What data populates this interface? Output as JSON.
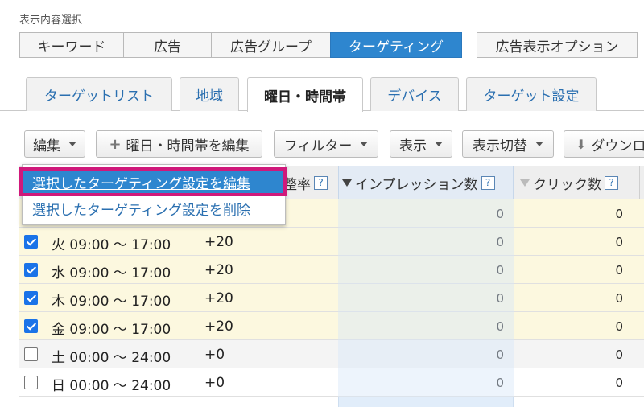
{
  "section_label": "表示内容選択",
  "segments": [
    {
      "label": "キーワード",
      "active": false
    },
    {
      "label": "広告",
      "active": false
    },
    {
      "label": "広告グループ",
      "active": false
    },
    {
      "label": "ターゲティング",
      "active": true
    }
  ],
  "extra_segment": "広告表示オプション",
  "tabs": [
    {
      "label": "ターゲットリスト",
      "active": false
    },
    {
      "label": "地域",
      "active": false
    },
    {
      "label": "曜日・時間帯",
      "active": true
    },
    {
      "label": "デバイス",
      "active": false
    },
    {
      "label": "ターゲット設定",
      "active": false
    }
  ],
  "toolbar": {
    "edit": "編集",
    "edit_schedule": "曜日・時間帯を編集",
    "filter": "フィルター",
    "display": "表示",
    "display_switch": "表示切替",
    "download": "ダウンロ"
  },
  "dropdown": {
    "item_edit": "選択したターゲティング設定を編集",
    "item_delete": "選択したターゲティング設定を削除"
  },
  "table": {
    "columns": {
      "adjust_rate": "整率",
      "impressions": "インプレッション数",
      "clicks": "クリック数"
    },
    "help_glyph": "?",
    "rows": [
      {
        "checked": false,
        "day": "",
        "adj": "",
        "impressions": "0",
        "clicks": "0"
      },
      {
        "checked": true,
        "day": "火 09:00 ～ 17:00",
        "adj": "+20",
        "impressions": "0",
        "clicks": "0"
      },
      {
        "checked": true,
        "day": "水 09:00 ～ 17:00",
        "adj": "+20",
        "impressions": "0",
        "clicks": "0"
      },
      {
        "checked": true,
        "day": "木 09:00 ～ 17:00",
        "adj": "+20",
        "impressions": "0",
        "clicks": "0"
      },
      {
        "checked": true,
        "day": "金 09:00 ～ 17:00",
        "adj": "+20",
        "impressions": "0",
        "clicks": "0"
      },
      {
        "checked": false,
        "day": "土 00:00 ～ 24:00",
        "adj": "+0",
        "impressions": "0",
        "clicks": "0"
      },
      {
        "checked": false,
        "day": "日 00:00 ～ 24:00",
        "adj": "+0",
        "impressions": "0",
        "clicks": "0"
      }
    ]
  },
  "colors": {
    "accent": "#2e86cf",
    "highlight_border": "#d0197b",
    "checked_row_bg": "#fcf8df",
    "unchecked_row_bg": "#f4f4f4",
    "impression_col_bg": "#eaf2fb"
  }
}
